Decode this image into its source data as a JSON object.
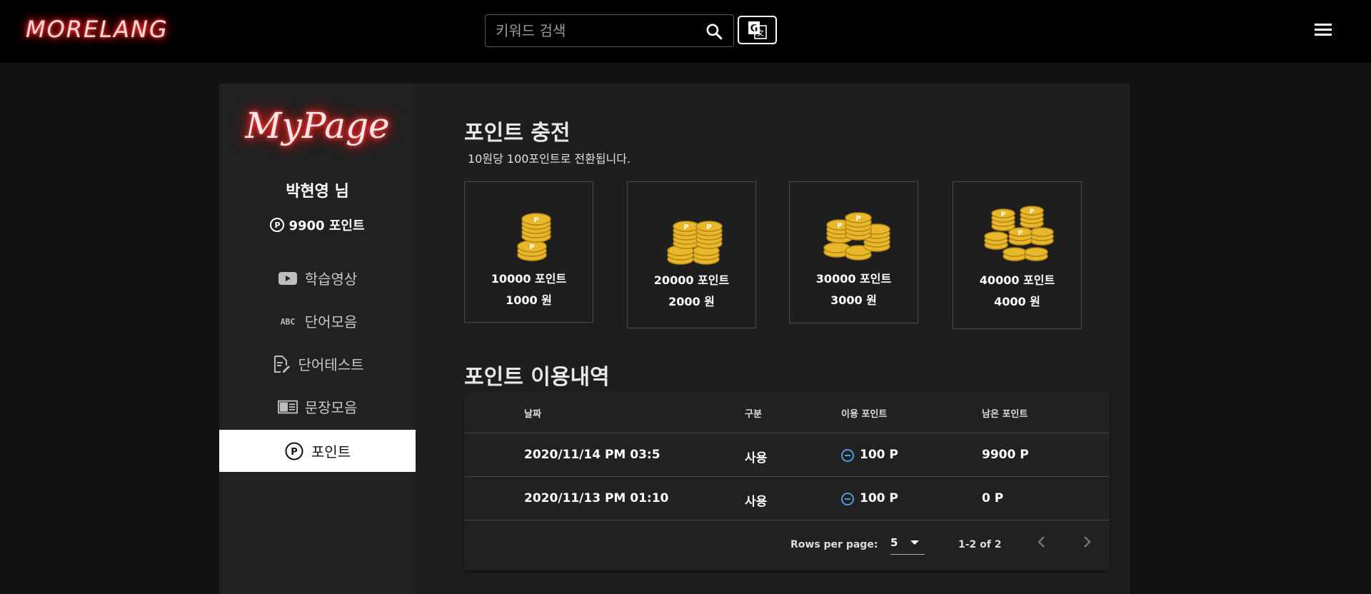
{
  "header": {
    "logo": "MORELANG",
    "search_placeholder": "키워드 검색",
    "icons": {
      "search": "search-icon",
      "translate": "translate-icon",
      "menu": "hamburger-menu-icon"
    }
  },
  "sidebar": {
    "title": "MyPage",
    "username": "박현영 님",
    "points": "9900 포인트",
    "items": [
      {
        "label": "학습영상",
        "icon": "youtube-icon"
      },
      {
        "label": "단어모음",
        "icon": "abc-icon"
      },
      {
        "label": "단어테스트",
        "icon": "edit-document-icon"
      },
      {
        "label": "문장모음",
        "icon": "chrome-reader-icon"
      },
      {
        "label": "포인트",
        "icon": "points-icon",
        "active": true
      }
    ]
  },
  "charge": {
    "title": "포인트 충전",
    "subtitle": "10원당 100포인트로 전환됩니다.",
    "packages": [
      {
        "points": "10000 포인트",
        "price": "1000 원",
        "icon": "coin-stack-1-icon"
      },
      {
        "points": "20000 포인트",
        "price": "2000 원",
        "icon": "coin-stack-2-icon"
      },
      {
        "points": "30000 포인트",
        "price": "3000 원",
        "icon": "coin-stack-3-icon"
      },
      {
        "points": "40000 포인트",
        "price": "4000 원",
        "icon": "coin-stack-4-icon"
      }
    ]
  },
  "history": {
    "title": "포인트 이용내역",
    "columns": [
      "날짜",
      "구분",
      "이용 포인트",
      "남은 포인트"
    ],
    "rows": [
      {
        "date": "2020/11/14 PM 03:5",
        "type": "사용",
        "used": "100 P",
        "remaining": "9900 P"
      },
      {
        "date": "2020/11/13 PM 01:10",
        "type": "사용",
        "used": "100 P",
        "remaining": "0 P"
      }
    ],
    "footer": {
      "rows_per_page_label": "Rows per page:",
      "rows_per_page": "5",
      "range": "1-2 of 2"
    }
  },
  "colors": {
    "coin": "#e8b82a",
    "accent_blue": "#4f9be0",
    "neon_red": "#ff1f1f"
  }
}
